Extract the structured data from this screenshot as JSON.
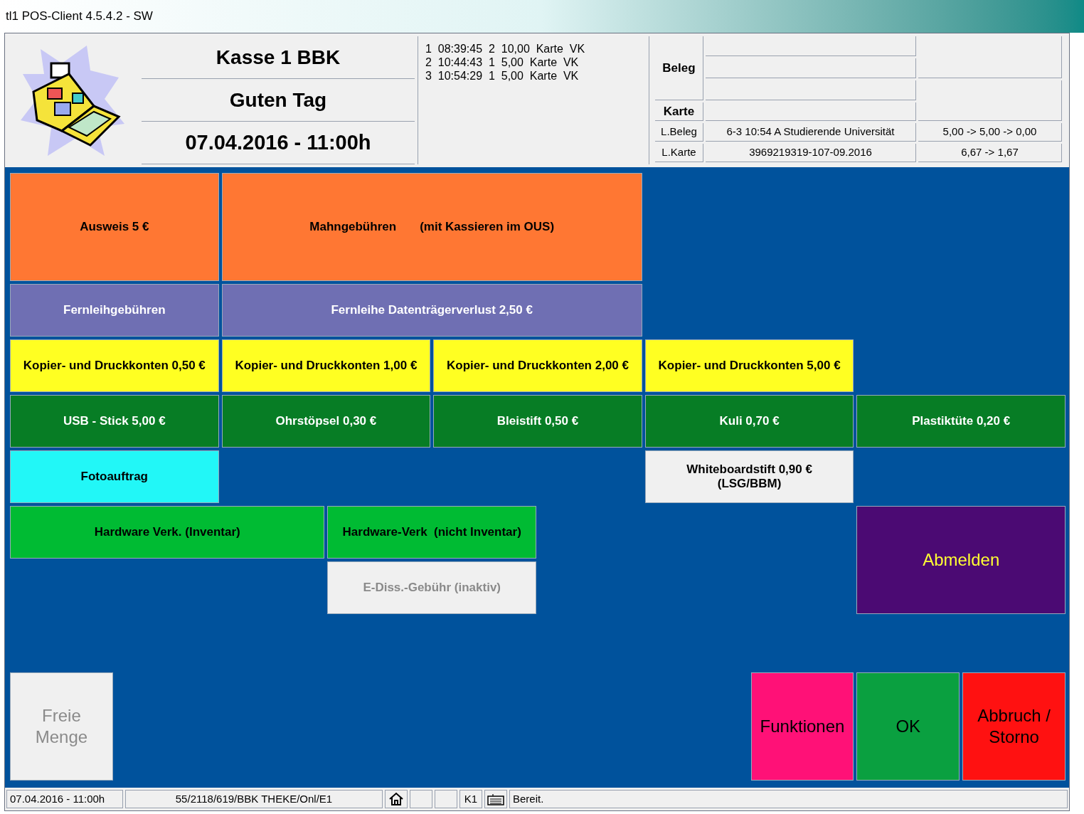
{
  "window": {
    "title": "tl1 POS-Client 4.5.4.2 - SW"
  },
  "header": {
    "lines": [
      "Kasse 1 BBK",
      "Guten Tag",
      "07.04.2016 - 11:00h"
    ],
    "transactions": [
      "1  08:39:45  2  10,00  Karte  VK",
      "2  10:44:43  1  5,00  Karte  VK",
      "3  10:54:29  1  5,00  Karte  VK"
    ],
    "info": {
      "beleg_label": "Beleg",
      "karte_label": "Karte",
      "rows": [
        {
          "label": "L.Beleg",
          "value": "6-3 10:54 A Studierende Universität",
          "amount": "5,00 -> 5,00 -> 0,00"
        },
        {
          "label": "L.Karte",
          "value": "3969219319-107-09.2016",
          "amount": "6,67 -> 1,67"
        }
      ]
    }
  },
  "buttons": [
    {
      "label": "Ausweis 5 €",
      "color": "#ff7733",
      "disabled": false
    },
    {
      "label": "Mahngebühren       (mit Kassieren im OUS)",
      "color": "#ff7733",
      "disabled": false
    },
    {
      "label": "Fernleihgebühren",
      "color": "#6f6fb3",
      "disabled": false
    },
    {
      "label": "Fernleihe Datenträgerverlust 2,50 €",
      "color": "#6f6fb3",
      "disabled": false
    },
    {
      "label": "Kopier- und Druckkonten 0,50 €",
      "color": "#ffff22",
      "disabled": false
    },
    {
      "label": "Kopier- und Druckkonten 1,00 €",
      "color": "#ffff22",
      "disabled": false
    },
    {
      "label": "Kopier- und Druckkonten 2,00 €",
      "color": "#ffff22",
      "disabled": false
    },
    {
      "label": "Kopier- und Druckkonten 5,00 €",
      "color": "#ffff22",
      "disabled": false
    },
    {
      "label": "USB - Stick 5,00 €",
      "color": "#077d25",
      "disabled": false
    },
    {
      "label": "Ohrstöpsel 0,30 €",
      "color": "#077d25",
      "disabled": false
    },
    {
      "label": "Bleistift 0,50 €",
      "color": "#077d25",
      "disabled": false
    },
    {
      "label": "Kuli 0,70 €",
      "color": "#077d25",
      "disabled": false
    },
    {
      "label": "Plastiktüte 0,20 €",
      "color": "#077d25",
      "disabled": false
    },
    {
      "label": "Fotoauftrag",
      "color": "#22f7f7",
      "disabled": false
    },
    {
      "label": "Whiteboardstift 0,90 €\n(LSG/BBM)",
      "color": "#f0f0f0",
      "disabled": false
    },
    {
      "label": "Hardware Verk. (Inventar)",
      "color": "#00bb33",
      "disabled": false
    },
    {
      "label": "Hardware-Verk  (nicht Inventar)",
      "color": "#00bb33",
      "disabled": false
    },
    {
      "label": "E-Diss.-Gebühr (inaktiv)",
      "color": "#f0f0f0",
      "disabled": true
    },
    {
      "label": "Abmelden",
      "color": "#4b0a73",
      "disabled": false
    },
    {
      "label": "Freie\nMenge",
      "color": "#f0f0f0",
      "disabled": true
    },
    {
      "label": "Funktionen",
      "color": "#ff1177",
      "disabled": false
    },
    {
      "label": "OK",
      "color": "#0aa040",
      "disabled": false
    },
    {
      "label": "Abbruch /\nStorno",
      "color": "#ff1111",
      "disabled": false
    }
  ],
  "status_bar": {
    "date": "07.04.2016 - 11:00h",
    "path": "55/2118/619/BBK THEKE/Onl/E1",
    "register": "K1",
    "message": "Bereit."
  }
}
